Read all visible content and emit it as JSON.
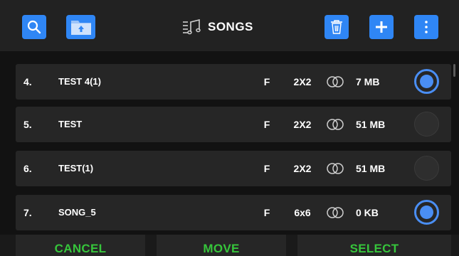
{
  "header": {
    "title": "SONGS",
    "icons": {
      "search": "search-icon",
      "folder_upload": "folder-upload-icon",
      "title": "music-list-icon",
      "delete": "trash-icon",
      "add": "plus-icon",
      "menu": "more-vertical-icon"
    }
  },
  "songs": [
    {
      "number": "4.",
      "name": "TEST 4(1)",
      "format": "F",
      "grid": "2X2",
      "size": "7 MB",
      "selected": true
    },
    {
      "number": "5.",
      "name": "TEST",
      "format": "F",
      "grid": "2X2",
      "size": "51 MB",
      "selected": false
    },
    {
      "number": "6.",
      "name": "TEST(1)",
      "format": "F",
      "grid": "2X2",
      "size": "51 MB",
      "selected": false
    },
    {
      "number": "7.",
      "name": "SONG_5",
      "format": "F",
      "grid": "6x6",
      "size": "0 KB",
      "selected": true
    }
  ],
  "footer": {
    "cancel_label": "CANCEL",
    "move_label": "MOVE",
    "select_label": "SELECT"
  },
  "colors": {
    "accent": "#2f86f5",
    "radio": "#4a8ef3",
    "action_text": "#36c53b",
    "row_bg": "#262626",
    "background": "#121212"
  }
}
